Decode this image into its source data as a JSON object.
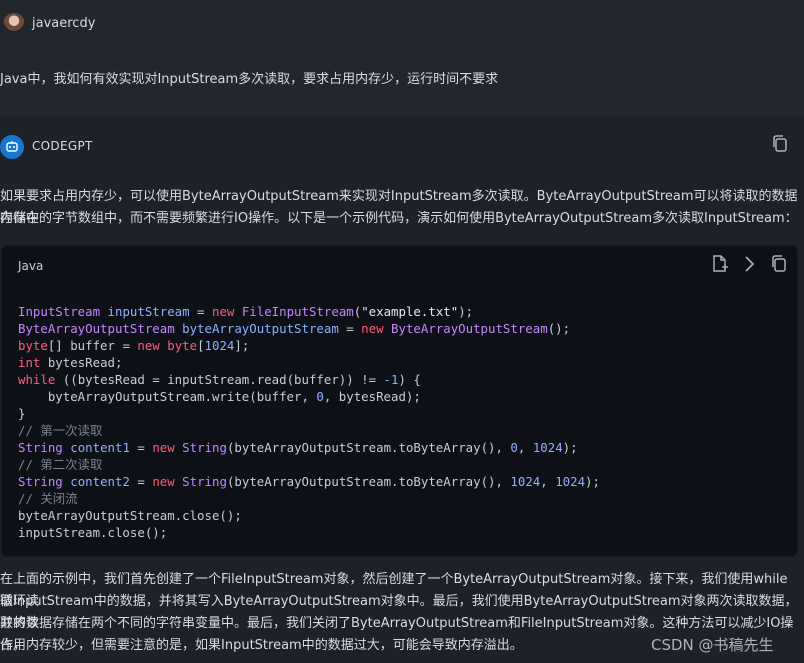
{
  "user": {
    "name": "javaercdy",
    "question": "Java中，我如何有效实现对InputStream多次读取，要求占用内存少，运行时间不要求"
  },
  "bot": {
    "name": "CODEGPT",
    "intro_line1": "如果要求占用内存少，可以使用ByteArrayOutputStream来实现对InputStream多次读取。ByteArrayOutputStream可以将读取的数据存储在",
    "intro_line2": "内存中的字节数组中，而不需要频繁进行IO操作。以下是一个示例代码，演示如何使用ByteArrayOutputStream多次读取InputStream：",
    "outro_line1": "在上面的示例中，我们首先创建了一个FileInputStream对象，然后创建了一个ByteArrayOutputStream对象。接下来，我们使用while循环读",
    "outro_line2": "取InputStream中的数据，并将其写入ByteArrayOutputStream对象中。最后，我们使用ByteArrayOutputStream对象两次读取数据，并将读",
    "outro_line3": "取的数据存储在两个不同的字符串变量中。最后，我们关闭了ByteArrayOutputStream和FileInputStream对象。这种方法可以减少IO操作，",
    "outro_line4": "占用内存较少，但需要注意的是，如果InputStream中的数据过大，可能会导致内存溢出。"
  },
  "code": {
    "language": "Java",
    "icons": [
      "new-file-icon",
      "chevron-right-icon",
      "copy-icon"
    ],
    "lines": [
      [
        [
          "ty",
          "InputStream"
        ],
        [
          "sp",
          " "
        ],
        [
          "vr",
          "inputStream"
        ],
        [
          "sp",
          " = "
        ],
        [
          "kw",
          "new"
        ],
        [
          "sp",
          " "
        ],
        [
          "ty",
          "FileInputStream"
        ],
        [
          "sp",
          "("
        ],
        [
          "st",
          "\"example.txt\""
        ],
        [
          "sp",
          ");"
        ]
      ],
      [
        [
          "ty",
          "ByteArrayOutputStream"
        ],
        [
          "sp",
          " "
        ],
        [
          "vr",
          "byteArrayOutputStream"
        ],
        [
          "sp",
          " = "
        ],
        [
          "kw",
          "new"
        ],
        [
          "sp",
          " "
        ],
        [
          "ty",
          "ByteArrayOutputStream"
        ],
        [
          "sp",
          "();"
        ]
      ],
      [
        [
          "kw",
          "byte"
        ],
        [
          "sp",
          "[] buffer = "
        ],
        [
          "kw",
          "new"
        ],
        [
          "sp",
          " "
        ],
        [
          "kw",
          "byte"
        ],
        [
          "sp",
          "["
        ],
        [
          "nm",
          "1024"
        ],
        [
          "sp",
          "];"
        ]
      ],
      [
        [
          "kw",
          "int"
        ],
        [
          "sp",
          " bytesRead;"
        ]
      ],
      [
        [
          "kw",
          "while"
        ],
        [
          "sp",
          " ((bytesRead = inputStream.read(buffer)) != "
        ],
        [
          "nm",
          "-1"
        ],
        [
          "sp",
          ") {"
        ]
      ],
      [
        [
          "sp",
          "    byteArrayOutputStream.write(buffer, "
        ],
        [
          "nm",
          "0"
        ],
        [
          "sp",
          ", bytesRead);"
        ]
      ],
      [
        [
          "sp",
          "}"
        ]
      ],
      [
        [
          "cm",
          "// 第一次读取"
        ]
      ],
      [
        [
          "ty",
          "String"
        ],
        [
          "sp",
          " "
        ],
        [
          "vr",
          "content1"
        ],
        [
          "sp",
          " = "
        ],
        [
          "kw",
          "new"
        ],
        [
          "sp",
          " "
        ],
        [
          "ty",
          "String"
        ],
        [
          "sp",
          "(byteArrayOutputStream.toByteArray(), "
        ],
        [
          "nm",
          "0"
        ],
        [
          "sp",
          ", "
        ],
        [
          "nm",
          "1024"
        ],
        [
          "sp",
          ");"
        ]
      ],
      [
        [
          "cm",
          "// 第二次读取"
        ]
      ],
      [
        [
          "ty",
          "String"
        ],
        [
          "sp",
          " "
        ],
        [
          "vr",
          "content2"
        ],
        [
          "sp",
          " = "
        ],
        [
          "kw",
          "new"
        ],
        [
          "sp",
          " "
        ],
        [
          "ty",
          "String"
        ],
        [
          "sp",
          "(byteArrayOutputStream.toByteArray(), "
        ],
        [
          "nm",
          "1024"
        ],
        [
          "sp",
          ", "
        ],
        [
          "nm",
          "1024"
        ],
        [
          "sp",
          ");"
        ]
      ],
      [
        [
          "cm",
          "// 关闭流"
        ]
      ],
      [
        [
          "sp",
          "byteArrayOutputStream.close();"
        ]
      ],
      [
        [
          "sp",
          "inputStream.close();"
        ]
      ]
    ]
  },
  "watermark": "CSDN @书稿先生",
  "colors": {
    "background": "#1e2128",
    "user_background": "#22262d",
    "code_background": "#0d1016",
    "keyword": "#ff5c79",
    "type": "#c586ff",
    "variable": "#8fb1ff",
    "comment": "#7c8290",
    "bot_accent": "#1677d2"
  }
}
